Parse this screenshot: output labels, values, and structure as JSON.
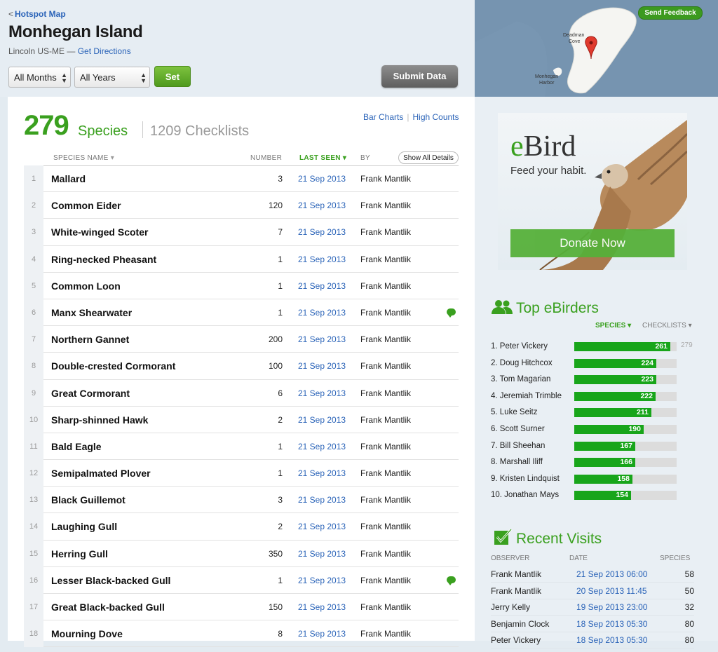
{
  "header": {
    "back_link": "Hotspot Map",
    "back_glyph": "<",
    "title": "Monhegan Island",
    "location": "Lincoln US-ME",
    "dash": "—",
    "directions": "Get Directions",
    "month_select": "All Months",
    "year_select": "All Years",
    "set_button": "Set",
    "submit_button": "Submit Data",
    "feedback_button": "Send Feedback"
  },
  "map": {
    "label_cove": "Deadman Cove",
    "label_harbor": "Monhegan Harbor"
  },
  "summary": {
    "species_count": "279",
    "species_label": "Species",
    "checklists": "1209 Checklists",
    "bar_charts": "Bar Charts",
    "link_separator": "|",
    "high_counts": "High Counts"
  },
  "table": {
    "col_name": "SPECIES NAME",
    "col_number": "NUMBER",
    "col_last_seen": "LAST SEEN",
    "col_by": "BY",
    "show_all": "Show All Details",
    "rows": [
      {
        "n": "1",
        "name": "Mallard",
        "count": "3",
        "date": "21 Sep 2013",
        "by": "Frank Mantlik",
        "comment": false
      },
      {
        "n": "2",
        "name": "Common Eider",
        "count": "120",
        "date": "21 Sep 2013",
        "by": "Frank Mantlik",
        "comment": false
      },
      {
        "n": "3",
        "name": "White-winged Scoter",
        "count": "7",
        "date": "21 Sep 2013",
        "by": "Frank Mantlik",
        "comment": false
      },
      {
        "n": "4",
        "name": "Ring-necked Pheasant",
        "count": "1",
        "date": "21 Sep 2013",
        "by": "Frank Mantlik",
        "comment": false
      },
      {
        "n": "5",
        "name": "Common Loon",
        "count": "1",
        "date": "21 Sep 2013",
        "by": "Frank Mantlik",
        "comment": false
      },
      {
        "n": "6",
        "name": "Manx Shearwater",
        "count": "1",
        "date": "21 Sep 2013",
        "by": "Frank Mantlik",
        "comment": true
      },
      {
        "n": "7",
        "name": "Northern Gannet",
        "count": "200",
        "date": "21 Sep 2013",
        "by": "Frank Mantlik",
        "comment": false
      },
      {
        "n": "8",
        "name": "Double-crested Cormorant",
        "count": "100",
        "date": "21 Sep 2013",
        "by": "Frank Mantlik",
        "comment": false
      },
      {
        "n": "9",
        "name": "Great Cormorant",
        "count": "6",
        "date": "21 Sep 2013",
        "by": "Frank Mantlik",
        "comment": false
      },
      {
        "n": "10",
        "name": "Sharp-shinned Hawk",
        "count": "2",
        "date": "21 Sep 2013",
        "by": "Frank Mantlik",
        "comment": false
      },
      {
        "n": "11",
        "name": "Bald Eagle",
        "count": "1",
        "date": "21 Sep 2013",
        "by": "Frank Mantlik",
        "comment": false
      },
      {
        "n": "12",
        "name": "Semipalmated Plover",
        "count": "1",
        "date": "21 Sep 2013",
        "by": "Frank Mantlik",
        "comment": false
      },
      {
        "n": "13",
        "name": "Black Guillemot",
        "count": "3",
        "date": "21 Sep 2013",
        "by": "Frank Mantlik",
        "comment": false
      },
      {
        "n": "14",
        "name": "Laughing Gull",
        "count": "2",
        "date": "21 Sep 2013",
        "by": "Frank Mantlik",
        "comment": false
      },
      {
        "n": "15",
        "name": "Herring Gull",
        "count": "350",
        "date": "21 Sep 2013",
        "by": "Frank Mantlik",
        "comment": false
      },
      {
        "n": "16",
        "name": "Lesser Black-backed Gull",
        "count": "1",
        "date": "21 Sep 2013",
        "by": "Frank Mantlik",
        "comment": true
      },
      {
        "n": "17",
        "name": "Great Black-backed Gull",
        "count": "150",
        "date": "21 Sep 2013",
        "by": "Frank Mantlik",
        "comment": false
      },
      {
        "n": "18",
        "name": "Mourning Dove",
        "count": "8",
        "date": "21 Sep 2013",
        "by": "Frank Mantlik",
        "comment": false
      }
    ]
  },
  "ad": {
    "brand_e": "e",
    "brand_rest": "Bird",
    "tagline": "Feed your habit.",
    "donate": "Donate Now"
  },
  "top_ebirders": {
    "title": "Top eBirders",
    "tab_species": "SPECIES ▾",
    "tab_checklists": "CHECKLISTS ▾",
    "max_value": "279",
    "max": 279,
    "birders": [
      {
        "rank_name": "1. Peter Vickery",
        "value": "261",
        "v": 261
      },
      {
        "rank_name": "2. Doug Hitchcox",
        "value": "224",
        "v": 224
      },
      {
        "rank_name": "3. Tom Magarian",
        "value": "223",
        "v": 223
      },
      {
        "rank_name": "4. Jeremiah Trimble",
        "value": "222",
        "v": 222
      },
      {
        "rank_name": "5. Luke Seitz",
        "value": "211",
        "v": 211
      },
      {
        "rank_name": "6. Scott Surner",
        "value": "190",
        "v": 190
      },
      {
        "rank_name": "7. Bill Sheehan",
        "value": "167",
        "v": 167
      },
      {
        "rank_name": "8. Marshall Iliff",
        "value": "166",
        "v": 166
      },
      {
        "rank_name": "9. Kristen Lindquist",
        "value": "158",
        "v": 158
      },
      {
        "rank_name": "10. Jonathan Mays",
        "value": "154",
        "v": 154
      }
    ]
  },
  "recent_visits": {
    "title": "Recent Visits",
    "col_observer": "OBSERVER",
    "col_date": "DATE",
    "col_species": "SPECIES",
    "visits": [
      {
        "observer": "Frank Mantlik",
        "date": "21 Sep 2013 06:00",
        "species": "58"
      },
      {
        "observer": "Frank Mantlik",
        "date": "20 Sep 2013 11:45",
        "species": "50"
      },
      {
        "observer": "Jerry Kelly",
        "date": "19 Sep 2013 23:00",
        "species": "32"
      },
      {
        "observer": "Benjamin Clock",
        "date": "18 Sep 2013 05:30",
        "species": "80"
      },
      {
        "observer": "Peter Vickery",
        "date": "18 Sep 2013 05:30",
        "species": "80"
      }
    ]
  },
  "colors": {
    "accent_green": "#3aa01f",
    "bar_green": "#18a51a",
    "link_blue": "#2a63b8"
  }
}
